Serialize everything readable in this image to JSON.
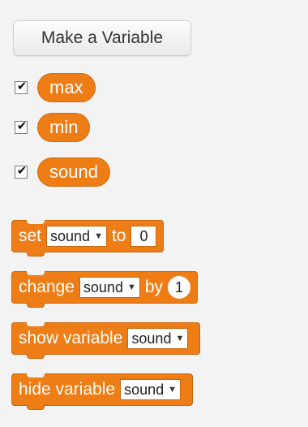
{
  "palette": {
    "make_variable_button": "Make a Variable",
    "variables": [
      {
        "name": "max",
        "checked": true
      },
      {
        "name": "min",
        "checked": true
      },
      {
        "name": "sound",
        "checked": true
      }
    ],
    "blocks": {
      "set": {
        "label": "set",
        "variable": "sound",
        "connector": "to",
        "value": "0"
      },
      "change": {
        "label": "change",
        "variable": "sound",
        "connector": "by",
        "value": "1"
      },
      "show": {
        "label": "show variable",
        "variable": "sound"
      },
      "hide": {
        "label": "hide variable",
        "variable": "sound"
      }
    }
  },
  "icons": {
    "checkbox": "checkmark-icon",
    "dropdown": "triangle-down-icon"
  },
  "colors": {
    "block_orange": "#ee7d16",
    "background": "#f3f3f3"
  }
}
